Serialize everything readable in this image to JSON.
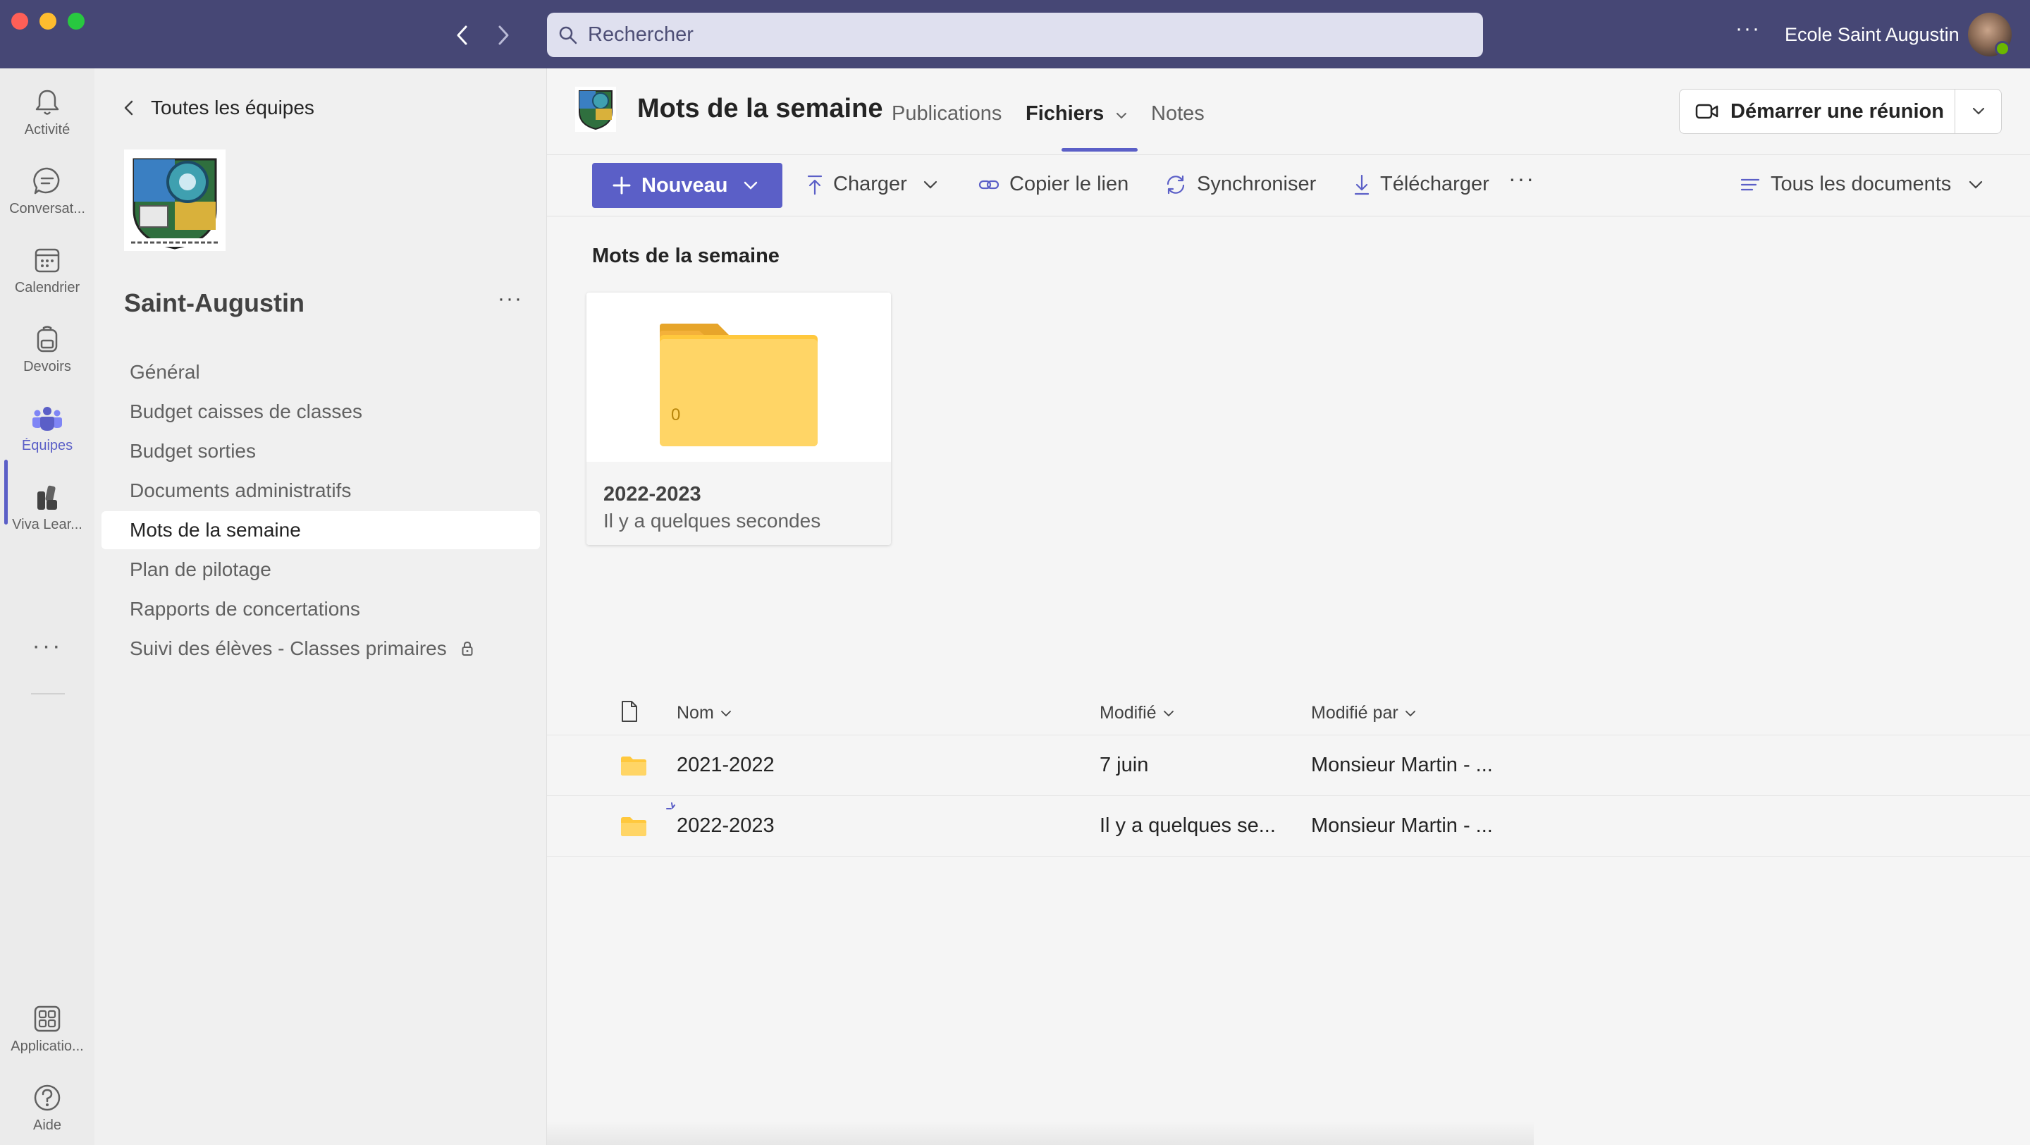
{
  "titlebar": {
    "search_placeholder": "Rechercher",
    "more": "···",
    "org_name": "Ecole Saint Augustin"
  },
  "rail": {
    "items": [
      {
        "label": "Activité",
        "icon": "bell-icon"
      },
      {
        "label": "Conversat...",
        "icon": "chat-icon"
      },
      {
        "label": "Calendrier",
        "icon": "calendar-icon"
      },
      {
        "label": "Devoirs",
        "icon": "backpack-icon"
      },
      {
        "label": "Équipes",
        "icon": "teams-icon"
      },
      {
        "label": "Viva Lear...",
        "icon": "learning-icon"
      },
      {
        "label": "Applicatio...",
        "icon": "apps-icon"
      },
      {
        "label": "Aide",
        "icon": "help-icon"
      }
    ],
    "more": "···"
  },
  "team": {
    "back_label": "Toutes les équipes",
    "name": "Saint-Augustin",
    "more": "···",
    "channels": [
      "Général",
      "Budget caisses de classes",
      "Budget sorties",
      "Documents administratifs",
      "Mots de la semaine",
      "Plan de pilotage",
      "Rapports de concertations",
      "Suivi des élèves - Classes primaires"
    ]
  },
  "header": {
    "channel_title": "Mots de la semaine",
    "tabs": [
      "Publications",
      "Fichiers",
      "Notes"
    ],
    "meet_button": "Démarrer une réunion"
  },
  "commands": {
    "new": "Nouveau",
    "upload": "Charger",
    "copy_link": "Copier le lien",
    "sync": "Synchroniser",
    "download": "Télécharger",
    "more": "···",
    "view": "Tous les documents"
  },
  "content": {
    "section_title": "Mots de la semaine",
    "tile": {
      "name": "2022-2023",
      "meta": "Il y a quelques secondes",
      "count": "0"
    },
    "columns": {
      "name": "Nom",
      "modified": "Modifié",
      "modified_by": "Modifié par"
    },
    "rows": [
      {
        "name": "2021-2022",
        "modified": "7 juin",
        "modified_by": "Monsieur Martin - ..."
      },
      {
        "name": "2022-2023",
        "modified": "Il y a quelques se...",
        "modified_by": "Monsieur Martin - ..."
      }
    ]
  },
  "colors": {
    "titlebar": "#464775",
    "accent": "#5b5fc7",
    "folder": "#ffc83d"
  }
}
